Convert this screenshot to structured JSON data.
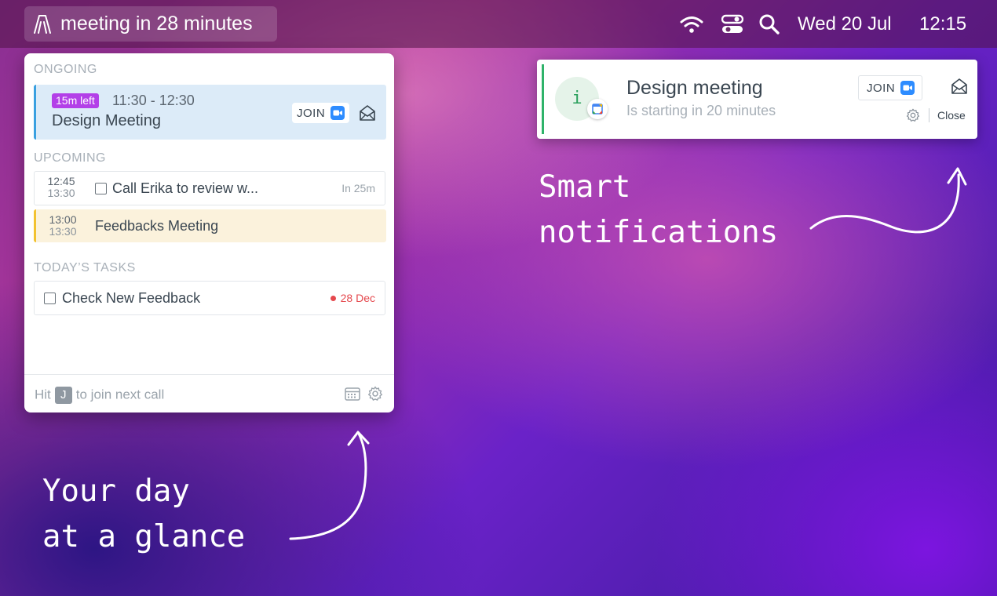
{
  "menubar": {
    "app_title": "meeting in 28 minutes",
    "date": "Wed 20 Jul",
    "time": "12:15",
    "icons": [
      "app-logo-icon",
      "wifi-icon",
      "control-center-icon",
      "search-icon"
    ]
  },
  "popover": {
    "ongoing_label": "ONGOING",
    "ongoing": {
      "badge": "15m left",
      "time": "11:30 - 12:30",
      "title": "Design Meeting",
      "join_label": "JOIN"
    },
    "upcoming_label": "UPCOMING",
    "upcoming": [
      {
        "start": "12:45",
        "end": "13:30",
        "title": "Call Erika to review w...",
        "meta": "In 25m"
      },
      {
        "start": "13:00",
        "end": "13:30",
        "title": "Feedbacks Meeting"
      }
    ],
    "tasks_label": "TODAY’S TASKS",
    "tasks": [
      {
        "title": "Check New Feedback",
        "due": "28 Dec"
      }
    ],
    "footer": {
      "prefix": "Hit",
      "key": "J",
      "suffix": "to join next call"
    }
  },
  "notification": {
    "avatar_letter": "i",
    "title": "Design meeting",
    "subtitle": "Is starting in 20 minutes",
    "join_label": "JOIN",
    "close_label": "Close"
  },
  "captions": {
    "smart_line1": "Smart",
    "smart_line2": "notifications",
    "day_line1": "Your day",
    "day_line2": "at a glance"
  },
  "colors": {
    "ongoing_accent": "#3aa0e0",
    "badge": "#b340e8",
    "upcoming_highlight": "#fbf2dc",
    "upcoming_highlight_border": "#f2c230",
    "due_dot": "#e5484d",
    "notif_accent": "#2fb36a",
    "zoom": "#2d8cff"
  }
}
